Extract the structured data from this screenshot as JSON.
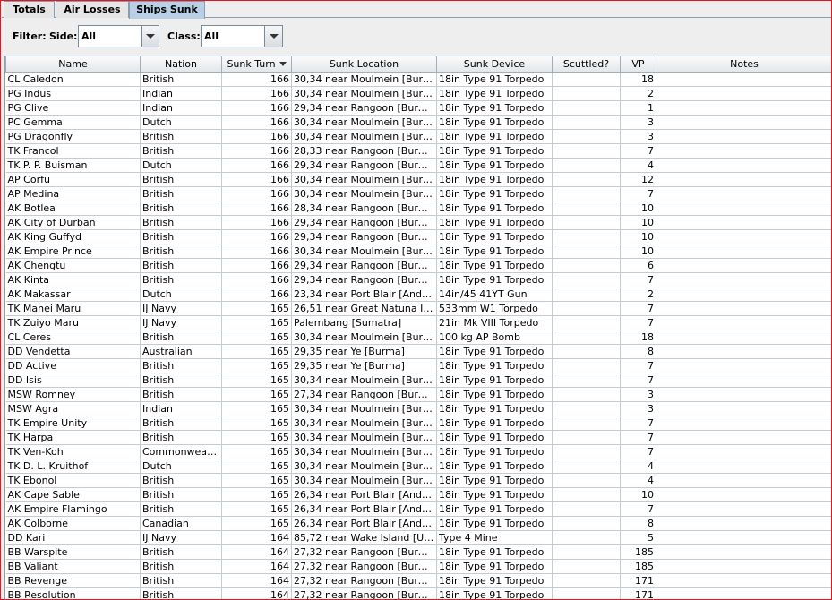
{
  "tabs": [
    {
      "label": "Totals",
      "active": false
    },
    {
      "label": "Air Losses",
      "active": false
    },
    {
      "label": "Ships Sunk",
      "active": true
    }
  ],
  "filter": {
    "label": "Filter:",
    "side_label": "Side:",
    "side_value": "All",
    "class_label": "Class:",
    "class_value": "All"
  },
  "table": {
    "columns": [
      "Name",
      "Nation",
      "Sunk Turn",
      "Sunk Location",
      "Sunk Device",
      "Scuttled?",
      "VP",
      "Notes"
    ],
    "sorted_column": "Sunk Turn",
    "rows": [
      [
        "CL Caledon",
        "British",
        "166",
        "30,34 near Moulmein [Burma]",
        "18in Type 91 Torpedo",
        "",
        "18",
        ""
      ],
      [
        "PG Indus",
        "Indian",
        "166",
        "30,34 near Moulmein [Burma]",
        "18in Type 91 Torpedo",
        "",
        "2",
        ""
      ],
      [
        "PG Clive",
        "Indian",
        "166",
        "29,34 near Rangoon [Burma]",
        "18in Type 91 Torpedo",
        "",
        "1",
        ""
      ],
      [
        "PC Gemma",
        "Dutch",
        "166",
        "30,34 near Moulmein [Burma]",
        "18in Type 91 Torpedo",
        "",
        "3",
        ""
      ],
      [
        "PG Dragonfly",
        "British",
        "166",
        "30,34 near Moulmein [Burma]",
        "18in Type 91 Torpedo",
        "",
        "3",
        ""
      ],
      [
        "TK Francol",
        "British",
        "166",
        "28,33 near Rangoon [Burma]",
        "18in Type 91 Torpedo",
        "",
        "7",
        ""
      ],
      [
        "TK P. P. Buisman",
        "Dutch",
        "166",
        "29,34 near Rangoon [Burma]",
        "18in Type 91 Torpedo",
        "",
        "4",
        ""
      ],
      [
        "AP Corfu",
        "British",
        "166",
        "30,34 near Moulmein [Burma]",
        "18in Type 91 Torpedo",
        "",
        "12",
        ""
      ],
      [
        "AP Medina",
        "British",
        "166",
        "30,34 near Moulmein [Burma]",
        "18in Type 91 Torpedo",
        "",
        "7",
        ""
      ],
      [
        "AK Botlea",
        "British",
        "166",
        "28,34 near Rangoon [Burma]",
        "18in Type 91 Torpedo",
        "",
        "10",
        ""
      ],
      [
        "AK City of Durban",
        "British",
        "166",
        "29,34 near Rangoon [Burma]",
        "18in Type 91 Torpedo",
        "",
        "10",
        ""
      ],
      [
        "AK King Guffyd",
        "British",
        "166",
        "29,34 near Rangoon [Burma]",
        "18in Type 91 Torpedo",
        "",
        "10",
        ""
      ],
      [
        "AK Empire Prince",
        "British",
        "166",
        "30,34 near Moulmein [Burma]",
        "18in Type 91 Torpedo",
        "",
        "10",
        ""
      ],
      [
        "AK Chengtu",
        "British",
        "166",
        "29,34 near Rangoon [Burma]",
        "18in Type 91 Torpedo",
        "",
        "6",
        ""
      ],
      [
        "AK Kinta",
        "British",
        "166",
        "29,34 near Rangoon [Burma]",
        "18in Type 91 Torpedo",
        "",
        "7",
        ""
      ],
      [
        "AK Makassar",
        "Dutch",
        "166",
        "23,34 near Port Blair [Andaman Islands]",
        "14in/45 41YT Gun",
        "",
        "2",
        ""
      ],
      [
        "TK Manei Maru",
        "IJ Navy",
        "165",
        "26,51 near Great Natuna I [Natuna]",
        "533mm W1 Torpedo",
        "",
        "7",
        ""
      ],
      [
        "TK Zuiyo Maru",
        "IJ Navy",
        "165",
        "Palembang [Sumatra]",
        "21in Mk VIII Torpedo",
        "",
        "7",
        ""
      ],
      [
        "CL Ceres",
        "British",
        "165",
        "30,34 near Moulmein [Burma]",
        "100 kg AP Bomb",
        "",
        "18",
        ""
      ],
      [
        "DD Vendetta",
        "Australian",
        "165",
        "29,35 near Ye [Burma]",
        "18in Type 91 Torpedo",
        "",
        "8",
        ""
      ],
      [
        "DD Active",
        "British",
        "165",
        "29,35 near Ye [Burma]",
        "18in Type 91 Torpedo",
        "",
        "7",
        ""
      ],
      [
        "DD Isis",
        "British",
        "165",
        "30,34 near Moulmein [Burma]",
        "18in Type 91 Torpedo",
        "",
        "7",
        ""
      ],
      [
        "MSW Romney",
        "British",
        "165",
        "27,34 near Rangoon [Burma]",
        "18in Type 91 Torpedo",
        "",
        "3",
        ""
      ],
      [
        "MSW Agra",
        "Indian",
        "165",
        "30,34 near Moulmein [Burma]",
        "18in Type 91 Torpedo",
        "",
        "3",
        ""
      ],
      [
        "TK Empire Unity",
        "British",
        "165",
        "30,34 near Moulmein [Burma]",
        "18in Type 91 Torpedo",
        "",
        "7",
        ""
      ],
      [
        "TK Harpa",
        "British",
        "165",
        "30,34 near Moulmein [Burma]",
        "18in Type 91 Torpedo",
        "",
        "7",
        ""
      ],
      [
        "TK Ven-Koh",
        "Commonwealth",
        "165",
        "30,34 near Moulmein [Burma]",
        "18in Type 91 Torpedo",
        "",
        "7",
        ""
      ],
      [
        "TK D. L. Kruithof",
        "Dutch",
        "165",
        "30,34 near Moulmein [Burma]",
        "18in Type 91 Torpedo",
        "",
        "4",
        ""
      ],
      [
        "TK Ebonol",
        "British",
        "165",
        "30,34 near Moulmein [Burma]",
        "18in Type 91 Torpedo",
        "",
        "4",
        ""
      ],
      [
        "AK Cape Sable",
        "British",
        "165",
        "26,34 near Port Blair [Andaman Islands]",
        "18in Type 91 Torpedo",
        "",
        "10",
        ""
      ],
      [
        "AK Empire Flamingo",
        "British",
        "165",
        "26,34 near Port Blair [Andaman Islands]",
        "18in Type 91 Torpedo",
        "",
        "7",
        ""
      ],
      [
        "AK Colborne",
        "Canadian",
        "165",
        "26,34 near Port Blair [Andaman Islands]",
        "18in Type 91 Torpedo",
        "",
        "8",
        ""
      ],
      [
        "DD Kari",
        "IJ Navy",
        "164",
        "85,72 near Wake Island [USA]",
        "Type 4 Mine",
        "",
        "5",
        ""
      ],
      [
        "BB Warspite",
        "British",
        "164",
        "27,32 near Rangoon [Burma]",
        "18in Type 91 Torpedo",
        "",
        "185",
        ""
      ],
      [
        "BB Valiant",
        "British",
        "164",
        "27,32 near Rangoon [Burma]",
        "18in Type 91 Torpedo",
        "",
        "185",
        ""
      ],
      [
        "BB Revenge",
        "British",
        "164",
        "27,32 near Rangoon [Burma]",
        "18in Type 91 Torpedo",
        "",
        "171",
        ""
      ],
      [
        "BB Resolution",
        "British",
        "164",
        "27,32 near Rangoon [Burma]",
        "18in Type 91 Torpedo",
        "",
        "171",
        ""
      ]
    ]
  }
}
